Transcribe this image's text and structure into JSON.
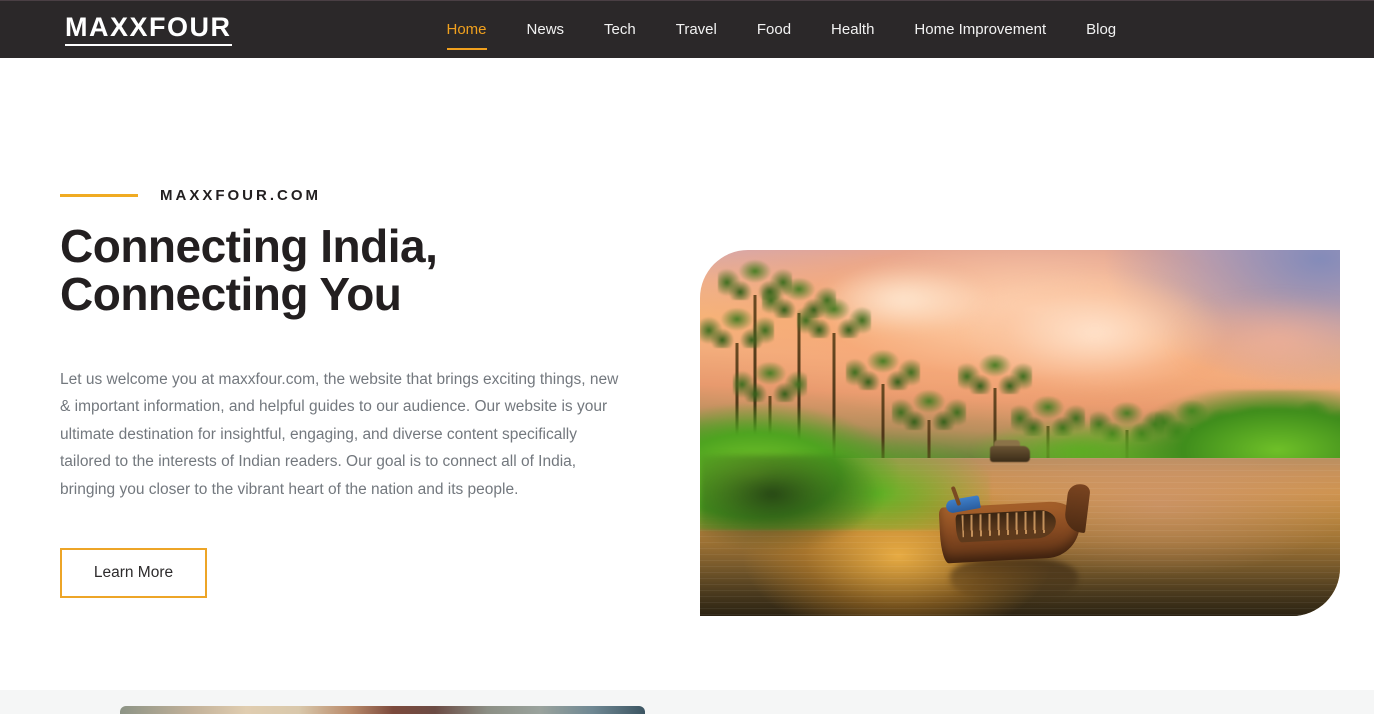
{
  "header": {
    "logo": "MAXXFOUR",
    "nav": [
      {
        "label": "Home",
        "active": true
      },
      {
        "label": "News",
        "active": false
      },
      {
        "label": "Tech",
        "active": false
      },
      {
        "label": "Travel",
        "active": false
      },
      {
        "label": "Food",
        "active": false
      },
      {
        "label": "Health",
        "active": false
      },
      {
        "label": "Home Improvement",
        "active": false
      },
      {
        "label": "Blog",
        "active": false
      }
    ],
    "background_color": "#2b2829",
    "accent_color": "#f0a01e"
  },
  "hero": {
    "eyebrow": "MAXXFOUR.COM",
    "title_line1": "Connecting India,",
    "title_line2": "Connecting You",
    "description": "Let us welcome you at maxxfour.com, the website that brings exciting things, new & important information, and helpful guides to our audience. Our website is your ultimate destination for insightful, engaging, and diverse content specifically tailored to the interests of Indian readers. Our goal is to connect all of India, bringing you closer to the vibrant heart of the nation and its people.",
    "cta_label": "Learn More",
    "accent_color": "#f0ab22",
    "image_alt": "Kerala backwaters at sunset with a traditional wooden canoe, palm trees and green riverbanks"
  },
  "lower_section": {
    "background_color": "#f5f6f6",
    "card_image_alt": "article card thumbnail"
  }
}
